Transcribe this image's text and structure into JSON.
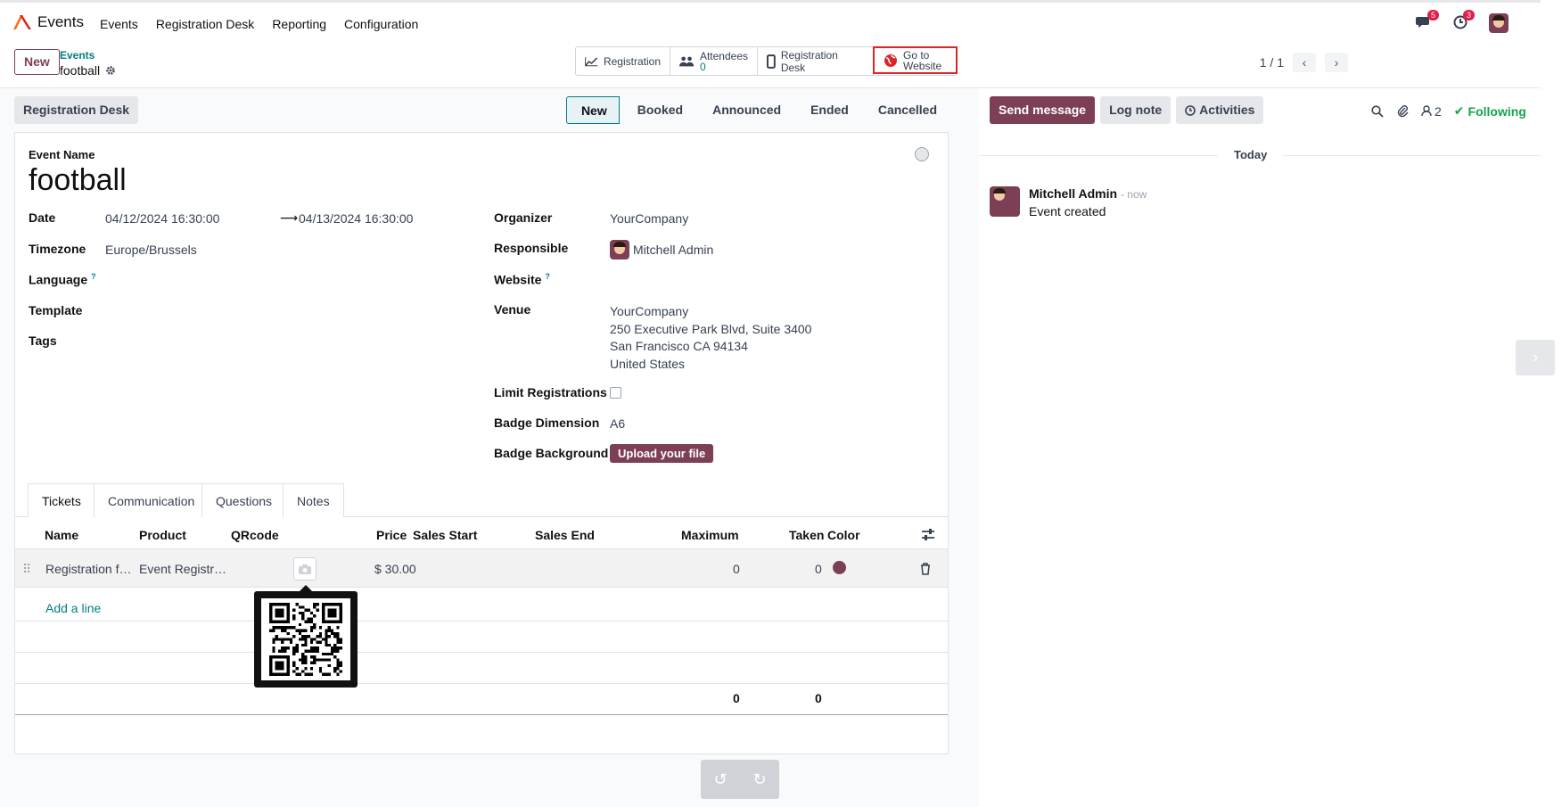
{
  "navbar": {
    "app_name": "Events",
    "menu": [
      "Events",
      "Registration Desk",
      "Reporting",
      "Configuration"
    ],
    "messages_count": "5",
    "activities_count": "3"
  },
  "control_panel": {
    "new_label": "New",
    "breadcrumb_parent": "Events",
    "breadcrumb_current": "football",
    "pager": "1 / 1"
  },
  "smart_buttons": {
    "registration": "Registration",
    "attendees_label": "Attendees",
    "attendees_count": "0",
    "registration_desk": "Registration Desk",
    "go_to_line1": "Go to",
    "go_to_line2": "Website"
  },
  "statusbar": {
    "registration_desk_button": "Registration Desk",
    "stages": [
      "New",
      "Booked",
      "Announced",
      "Ended",
      "Cancelled"
    ],
    "active_stage": "New"
  },
  "form": {
    "event_name_label": "Event Name",
    "event_name": "football",
    "date_label": "Date",
    "date_start": "04/12/2024 16:30:00",
    "date_end": "04/13/2024 16:30:00",
    "timezone_label": "Timezone",
    "timezone": "Europe/Brussels",
    "language_label": "Language",
    "template_label": "Template",
    "tags_label": "Tags",
    "organizer_label": "Organizer",
    "organizer": "YourCompany",
    "responsible_label": "Responsible",
    "responsible": "Mitchell Admin",
    "website_label": "Website",
    "venue_label": "Venue",
    "venue_line1": "YourCompany",
    "venue_line2": "250 Executive Park Blvd, Suite 3400",
    "venue_line3": "San Francisco CA 94134",
    "venue_line4": "United States",
    "limit_label": "Limit Registrations",
    "badge_dim_label": "Badge Dimension",
    "badge_dim": "A6",
    "badge_bg_label": "Badge Background",
    "upload_label": "Upload your file",
    "help_mark": "?"
  },
  "tabs": [
    "Tickets",
    "Communication",
    "Questions",
    "Notes"
  ],
  "tickets": {
    "columns": [
      "Name",
      "Product",
      "QRcode",
      "Price",
      "Sales Start",
      "Sales End",
      "Maximum",
      "Taken",
      "Color"
    ],
    "row": {
      "name": "Registration f…",
      "product": "Event Registr…",
      "price": "$ 30.00",
      "maximum": "0",
      "taken": "0",
      "color": "#7c3f56"
    },
    "add_line": "Add a line",
    "total_maximum": "0",
    "total_taken": "0"
  },
  "chatter": {
    "send_message": "Send message",
    "log_note": "Log note",
    "activities": "Activities",
    "followers_count": "2",
    "following": "Following",
    "date_separator": "Today",
    "author": "Mitchell Admin",
    "time": "- now",
    "body": "Event created"
  }
}
